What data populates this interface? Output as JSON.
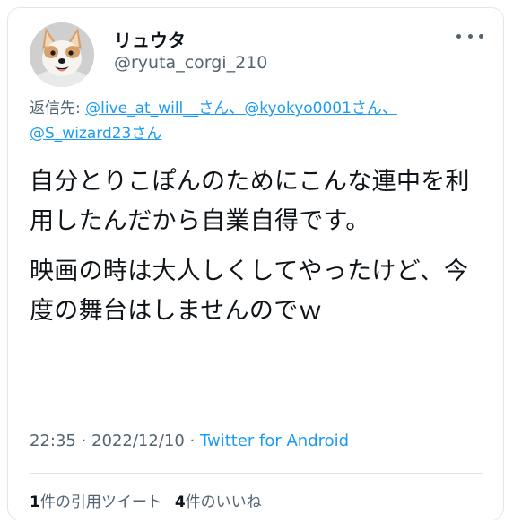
{
  "user": {
    "display_name": "リュウタ",
    "handle": "@ryuta_corgi_210",
    "avatar_icon": "corgi-avatar"
  },
  "reply": {
    "label": "返信先: ",
    "mentions": [
      "@live_at_will__さん",
      "@kyokyo0001さん",
      "@S_wizard23さん"
    ],
    "separator": "、"
  },
  "tweet": {
    "paragraph1": "自分とりこぽんのためにこんな連中を利用したんだから自業自得です。",
    "paragraph2": "映画の時は大人しくしてやったけど、今度の舞台はしませんのでｗ"
  },
  "meta": {
    "time": "22:35",
    "date": "2022/12/10",
    "dot": " · ",
    "source": "Twitter for Android"
  },
  "stats": {
    "quote_count": "1",
    "quote_label": "件の引用ツイート",
    "like_count": "4",
    "like_label": "件のいいね"
  },
  "colors": {
    "link": "#1d9bf0",
    "secondary": "#536471",
    "primary": "#0f1419"
  }
}
